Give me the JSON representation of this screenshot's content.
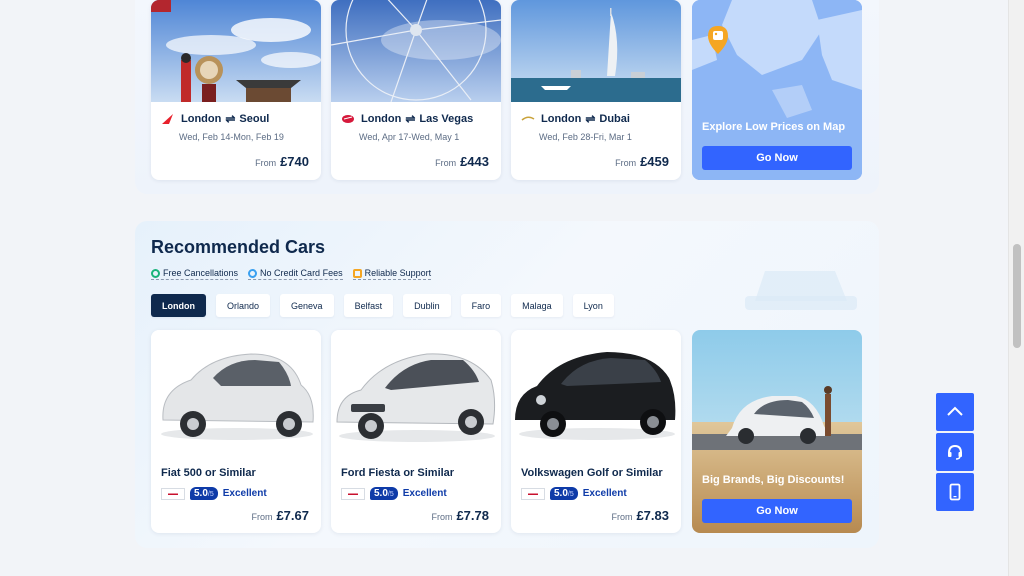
{
  "flights": {
    "cards": [
      {
        "from": "London",
        "swap": "⇌",
        "to": "Seoul",
        "dates": "Wed, Feb 14-Mon, Feb 19",
        "price_from": "From",
        "price": "£740",
        "airline_color": "#e8202b"
      },
      {
        "from": "London",
        "swap": "⇌",
        "to": "Las Vegas",
        "dates": "Wed, Apr 17-Wed, May 1",
        "price_from": "From",
        "price": "£443",
        "airline_color": "#d6193b"
      },
      {
        "from": "London",
        "swap": "⇌",
        "to": "Dubai",
        "dates": "Wed, Feb 28-Fri, Mar 1",
        "price_from": "From",
        "price": "£459",
        "airline_color": "#c9a23a"
      }
    ],
    "map": {
      "caption": "Explore Low Prices on Map",
      "button": "Go Now"
    }
  },
  "cars": {
    "title": "Recommended Cars",
    "features": [
      {
        "label": "Free Cancellations",
        "color": "#1ab37a"
      },
      {
        "label": "No Credit Card Fees",
        "color": "#3aa0f0"
      },
      {
        "label": "Reliable Support",
        "color": "#f5a623"
      }
    ],
    "tabs": [
      "London",
      "Orlando",
      "Geneva",
      "Belfast",
      "Dublin",
      "Faro",
      "Malaga",
      "Lyon"
    ],
    "active_tab": "London",
    "cards": [
      {
        "name": "Fiat 500 or Similar",
        "score": "5.0",
        "out_of": "/5",
        "label": "Excellent",
        "price_from": "From",
        "price": "£7.67",
        "color": "#e4e6e8"
      },
      {
        "name": "Ford Fiesta or Similar",
        "score": "5.0",
        "out_of": "/5",
        "label": "Excellent",
        "price_from": "From",
        "price": "£7.78",
        "color": "#e6e8ea"
      },
      {
        "name": "Volkswagen Golf or Similar",
        "score": "5.0",
        "out_of": "/5",
        "label": "Excellent",
        "price_from": "From",
        "price": "£7.83",
        "color": "#1b1d20"
      }
    ],
    "promo": {
      "caption": "Big Brands, Big Discounts!",
      "button": "Go Now"
    }
  },
  "floating": {
    "icons": [
      "chevron-up-icon",
      "headset-icon",
      "mobile-phone-icon"
    ]
  },
  "colors": {
    "primary": "#3264ff",
    "navy": "#0f294d",
    "score_badge": "#0e3ba8"
  }
}
